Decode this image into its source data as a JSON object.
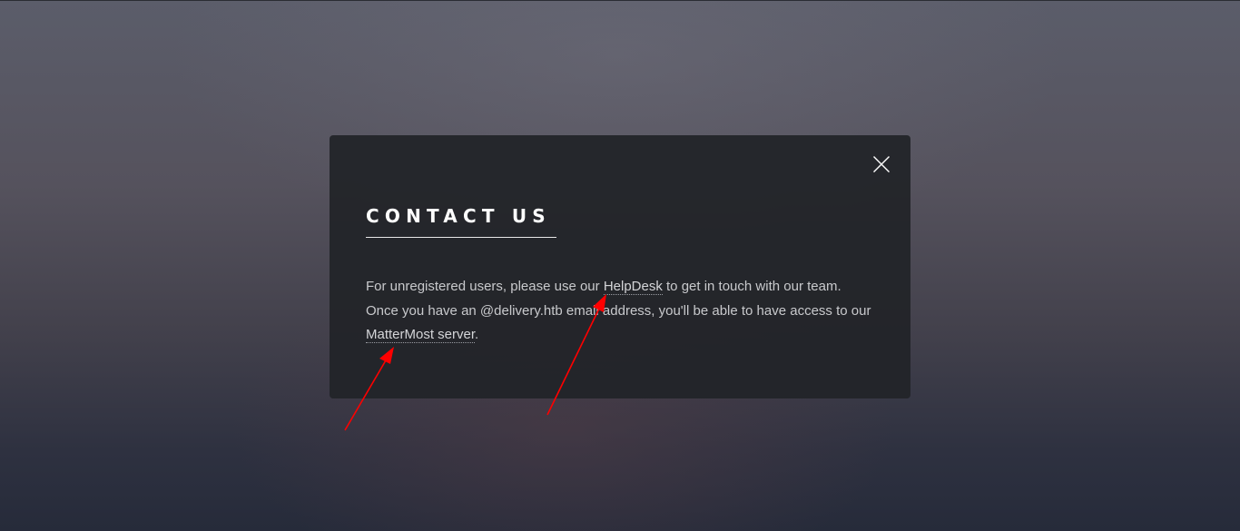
{
  "modal": {
    "title": "CONTACT US",
    "close_icon": "close-icon",
    "body": {
      "text_1": "For unregistered users, please use our ",
      "helpdesk_link": "HelpDesk",
      "text_2": " to get in touch with our team. Once you have an @delivery.htb email address, you'll be able to have access to our ",
      "mattermost_link": "MatterMost server",
      "text_3": "."
    }
  },
  "annotations": {
    "arrow_color": "#ff0000",
    "arrow_icon": "arrow-icon"
  },
  "colors": {
    "modal_bg": "#212328",
    "title": "#ffffff",
    "body_text": "#c8c9cc"
  }
}
